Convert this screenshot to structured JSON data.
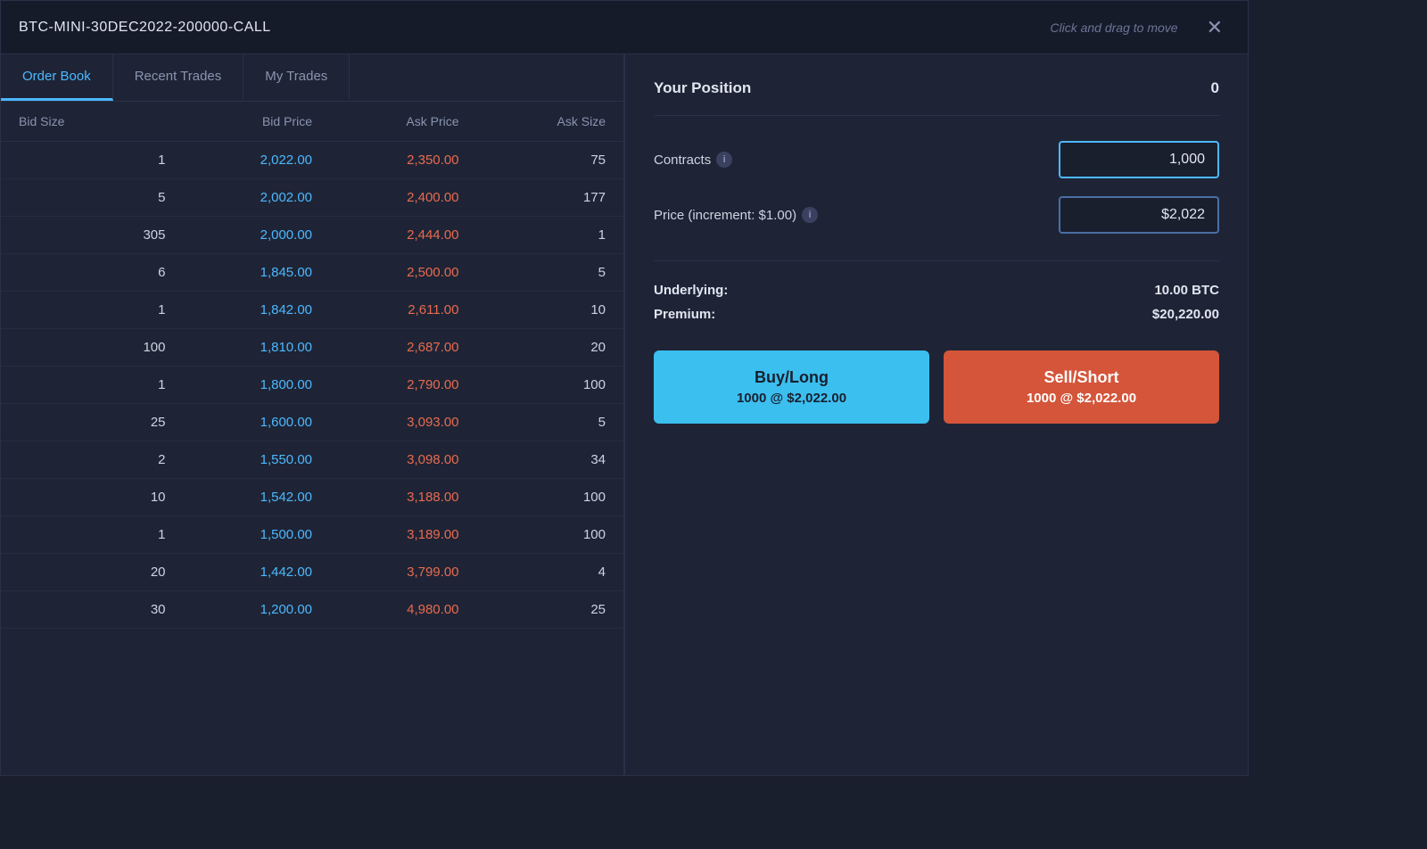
{
  "window": {
    "title": "BTC-MINI-30DEC2022-200000-CALL",
    "drag_hint": "Click and drag to move"
  },
  "tabs": [
    {
      "id": "order-book",
      "label": "Order Book",
      "active": true
    },
    {
      "id": "recent-trades",
      "label": "Recent Trades",
      "active": false
    },
    {
      "id": "my-trades",
      "label": "My Trades",
      "active": false
    }
  ],
  "order_book": {
    "headers": [
      "Bid Size",
      "Bid Price",
      "Ask Price",
      "Ask Size"
    ],
    "rows": [
      {
        "bid_size": "1",
        "bid_price": "2,022.00",
        "ask_price": "2,350.00",
        "ask_size": "75"
      },
      {
        "bid_size": "5",
        "bid_price": "2,002.00",
        "ask_price": "2,400.00",
        "ask_size": "177"
      },
      {
        "bid_size": "305",
        "bid_price": "2,000.00",
        "ask_price": "2,444.00",
        "ask_size": "1"
      },
      {
        "bid_size": "6",
        "bid_price": "1,845.00",
        "ask_price": "2,500.00",
        "ask_size": "5"
      },
      {
        "bid_size": "1",
        "bid_price": "1,842.00",
        "ask_price": "2,611.00",
        "ask_size": "10"
      },
      {
        "bid_size": "100",
        "bid_price": "1,810.00",
        "ask_price": "2,687.00",
        "ask_size": "20"
      },
      {
        "bid_size": "1",
        "bid_price": "1,800.00",
        "ask_price": "2,790.00",
        "ask_size": "100"
      },
      {
        "bid_size": "25",
        "bid_price": "1,600.00",
        "ask_price": "3,093.00",
        "ask_size": "5"
      },
      {
        "bid_size": "2",
        "bid_price": "1,550.00",
        "ask_price": "3,098.00",
        "ask_size": "34"
      },
      {
        "bid_size": "10",
        "bid_price": "1,542.00",
        "ask_price": "3,188.00",
        "ask_size": "100"
      },
      {
        "bid_size": "1",
        "bid_price": "1,500.00",
        "ask_price": "3,189.00",
        "ask_size": "100"
      },
      {
        "bid_size": "20",
        "bid_price": "1,442.00",
        "ask_price": "3,799.00",
        "ask_size": "4"
      },
      {
        "bid_size": "30",
        "bid_price": "1,200.00",
        "ask_price": "4,980.00",
        "ask_size": "25"
      }
    ]
  },
  "right_panel": {
    "position_label": "Your Position",
    "position_value": "0",
    "contracts_label": "Contracts",
    "contracts_value": "1,000",
    "price_label": "Price (increment: $1.00)",
    "price_value": "$2,022",
    "underlying_label": "Underlying:",
    "underlying_value": "10.00 BTC",
    "premium_label": "Premium:",
    "premium_value": "$20,220.00",
    "buy_button_line1": "Buy/Long",
    "buy_button_line2": "1000 @ $2,022.00",
    "sell_button_line1": "Sell/Short",
    "sell_button_line2": "1000 @ $2,022.00"
  },
  "colors": {
    "bid_price": "#4db8ff",
    "ask_price": "#e86a50",
    "buy_button": "#3bbfef",
    "sell_button": "#d4553a",
    "accent_blue": "#4db8ff"
  }
}
